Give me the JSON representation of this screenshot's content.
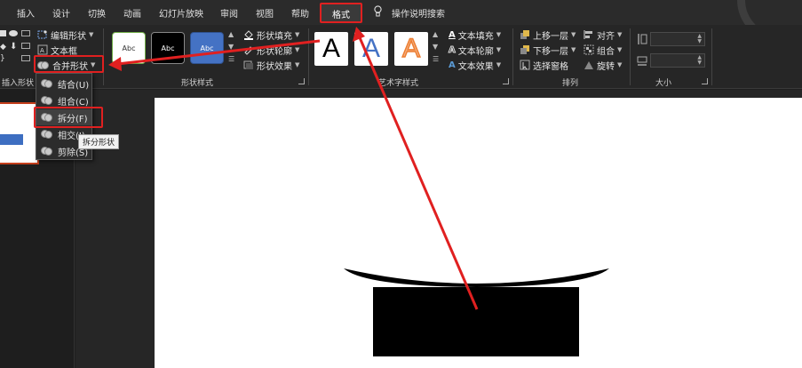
{
  "tabs": [
    "插入",
    "设计",
    "切换",
    "动画",
    "幻灯片放映",
    "审阅",
    "视图",
    "帮助"
  ],
  "active_tab": "格式",
  "tell_me": "操作说明搜索",
  "ribbon": {
    "insert_shapes": {
      "edit_shape": "编辑形状",
      "text_box": "文本框",
      "merge_shapes": "合并形状",
      "group_label": "插入形状"
    },
    "shape_styles": {
      "swatch_text": "Abc",
      "fill": "形状填充",
      "outline": "形状轮廓",
      "effects": "形状效果",
      "group_label": "形状样式"
    },
    "wordart": {
      "letter": "A",
      "text_fill": "文本填充",
      "text_outline": "文本轮廓",
      "text_effects": "文本效果",
      "group_label": "艺术字样式"
    },
    "arrange": {
      "bring_forward": "上移一层",
      "send_backward": "下移一层",
      "selection_pane": "选择窗格",
      "align": "对齐",
      "group": "组合",
      "rotate": "旋转",
      "group_label": "排列"
    },
    "size": {
      "group_label": "大小"
    }
  },
  "merge_menu": {
    "items": [
      "结合(U)",
      "组合(C)",
      "拆分(F)",
      "相交(I)",
      "剪除(S)"
    ],
    "highlighted": "拆分(F)",
    "tooltip": "拆分形状"
  },
  "colors": {
    "highlight_red": "#e02020",
    "ribbon_bg": "#262626",
    "accent_blue": "#4472c4",
    "wordart_orange": "#ed7d31"
  }
}
